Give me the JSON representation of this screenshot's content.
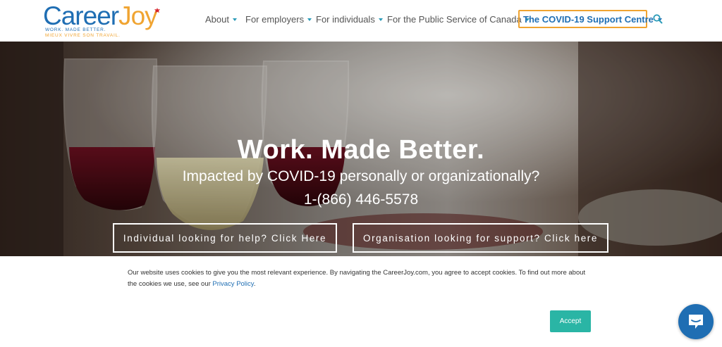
{
  "header": {
    "logo": {
      "career": "Career",
      "joy": "Joy",
      "tagline_en": "WORK. MADE BETTER.",
      "tagline_fr": "MIEUX VIVRE SON TRAVAIL."
    },
    "nav": {
      "about": "About",
      "employers": "For employers",
      "individuals": "For individuals",
      "public_service": "For the Public Service of Canada",
      "covid": "The COVID-19 Support Centre"
    },
    "search_icon": "search-icon"
  },
  "hero": {
    "title": "Work. Made Better.",
    "subtitle": "Impacted by COVID-19 personally or organizationally?",
    "phone": "1-(866) 446-5578",
    "button_individual": "Individual looking for help? Click Here",
    "button_organisation": "Organisation looking for support? Click here"
  },
  "cookie": {
    "text": "Our website uses cookies to give you the most relevant experience. By navigating the CareerJoy.com, you agree to accept cookies. To find out more about the cookies we use, see our ",
    "link": "Privacy Policy",
    "period": ".",
    "accept": "Accept"
  },
  "chat": {
    "icon": "chat-bubble-icon"
  },
  "colors": {
    "brand_blue": "#1f6eb3",
    "brand_orange": "#f0a431",
    "accept_teal": "#2ab5a5",
    "nav_caret": "#2a9bb8"
  }
}
